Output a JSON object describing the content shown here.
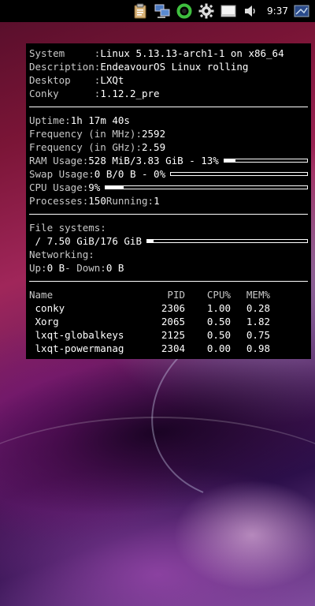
{
  "panel": {
    "clock": "9:37",
    "tray_icons": [
      "clipboard-icon",
      "network-icon",
      "status-ring-icon",
      "settings-gear-icon",
      "notes-icon",
      "volume-icon",
      "keyboard-layout-icon"
    ]
  },
  "conky": {
    "system": {
      "label": "System     :",
      "value": "Linux 5.13.13-arch1-1 on x86_64"
    },
    "description": {
      "label": "Description:",
      "value": "EndeavourOS Linux rolling"
    },
    "desktop": {
      "label": "Desktop    :",
      "value": "LXQt"
    },
    "conky_version": {
      "label": "Conky      :",
      "value": "1.12.2_pre"
    },
    "uptime": {
      "label": "Uptime:",
      "value": "1h 17m 40s"
    },
    "freq_mhz": {
      "label": "Frequency (in MHz):",
      "value": "2592"
    },
    "freq_ghz": {
      "label": "Frequency (in GHz):",
      "value": "2.59"
    },
    "ram": {
      "label": "RAM Usage:",
      "value": "528 MiB/3.83 GiB - 13%",
      "fraction": 0.13
    },
    "swap": {
      "label": "Swap Usage:",
      "value": "0 B/0 B - 0%",
      "fraction": 0.0
    },
    "cpu": {
      "label": "CPU Usage:",
      "value": "9%",
      "fraction": 0.09
    },
    "processes": {
      "label": "Processes:",
      "value": "150",
      "running_label": "Running:",
      "running_value": "1"
    },
    "filesystems": {
      "label": "File systems:",
      "root": " / 7.50 GiB/176 GiB",
      "fraction": 0.04
    },
    "networking": {
      "label": "Networking:",
      "up_label": "Up:",
      "up_value": "0 B",
      "down_label": "- Down:",
      "down_value": "0 B"
    },
    "process_table": {
      "headers": [
        "Name",
        "PID",
        "CPU%",
        "MEM%"
      ],
      "rows": [
        [
          " conky",
          "2306",
          "1.00",
          "0.28"
        ],
        [
          " Xorg",
          "2065",
          "0.50",
          "1.82"
        ],
        [
          " lxqt-globalkeys",
          "2125",
          "0.50",
          "0.75"
        ],
        [
          " lxqt-powermanag",
          "2304",
          "0.00",
          "0.98"
        ]
      ]
    }
  }
}
